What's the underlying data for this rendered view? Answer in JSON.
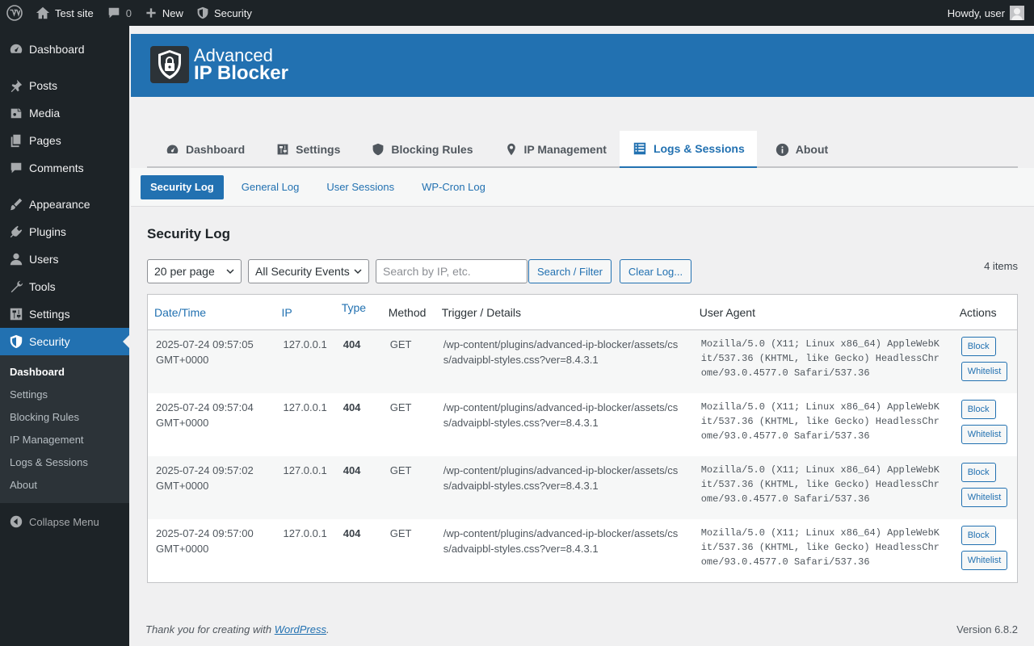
{
  "adminbar": {
    "site_name": "Test site",
    "comments_count": "0",
    "new_label": "New",
    "security_label": "Security",
    "greeting": "Howdy, user"
  },
  "sidebar": {
    "items": [
      {
        "label": "Dashboard",
        "icon": "dashboard-icon"
      },
      {
        "label": "Posts",
        "icon": "pin-icon"
      },
      {
        "label": "Media",
        "icon": "media-icon"
      },
      {
        "label": "Pages",
        "icon": "pages-icon"
      },
      {
        "label": "Comments",
        "icon": "comment-icon"
      },
      {
        "label": "Appearance",
        "icon": "brush-icon"
      },
      {
        "label": "Plugins",
        "icon": "plug-icon"
      },
      {
        "label": "Users",
        "icon": "user-icon"
      },
      {
        "label": "Tools",
        "icon": "wrench-icon"
      },
      {
        "label": "Settings",
        "icon": "settings-icon"
      },
      {
        "label": "Security",
        "icon": "shield-icon"
      }
    ],
    "submenu": [
      "Dashboard",
      "Settings",
      "Blocking Rules",
      "IP Management",
      "Logs & Sessions",
      "About"
    ],
    "collapse_label": "Collapse Menu"
  },
  "brand": {
    "line1": "Advanced",
    "line2": "IP Blocker"
  },
  "tabs": [
    "Dashboard",
    "Settings",
    "Blocking Rules",
    "IP Management",
    "Logs & Sessions",
    "About"
  ],
  "subtabs": [
    "Security Log",
    "General Log",
    "User Sessions",
    "WP-Cron Log"
  ],
  "page_title": "Security Log",
  "filters": {
    "per_page": "20 per page",
    "event_type": "All Security Events",
    "search_placeholder": "Search by IP, etc.",
    "search_button": "Search / Filter",
    "clear_button": "Clear Log..."
  },
  "items_count": "4 items",
  "table": {
    "headers": [
      "Date/Time",
      "IP",
      "Type",
      "Method",
      "Trigger / Details",
      "User Agent",
      "Actions"
    ],
    "rows": [
      {
        "date": "2025-07-24 09:57:05 GMT+0000",
        "ip": "127.0.0.1",
        "type": "404",
        "method": "GET",
        "trigger": "/wp-content/plugins/advanced-ip-blocker/assets/css/advaipbl-styles.css?ver=8.4.3.1",
        "ua": "Mozilla/5.0 (X11; Linux x86_64) AppleWebKit/537.36 (KHTML, like Gecko) HeadlessChrome/93.0.4577.0 Safari/537.36"
      },
      {
        "date": "2025-07-24 09:57:04 GMT+0000",
        "ip": "127.0.0.1",
        "type": "404",
        "method": "GET",
        "trigger": "/wp-content/plugins/advanced-ip-blocker/assets/css/advaipbl-styles.css?ver=8.4.3.1",
        "ua": "Mozilla/5.0 (X11; Linux x86_64) AppleWebKit/537.36 (KHTML, like Gecko) HeadlessChrome/93.0.4577.0 Safari/537.36"
      },
      {
        "date": "2025-07-24 09:57:02 GMT+0000",
        "ip": "127.0.0.1",
        "type": "404",
        "method": "GET",
        "trigger": "/wp-content/plugins/advanced-ip-blocker/assets/css/advaipbl-styles.css?ver=8.4.3.1",
        "ua": "Mozilla/5.0 (X11; Linux x86_64) AppleWebKit/537.36 (KHTML, like Gecko) HeadlessChrome/93.0.4577.0 Safari/537.36"
      },
      {
        "date": "2025-07-24 09:57:00 GMT+0000",
        "ip": "127.0.0.1",
        "type": "404",
        "method": "GET",
        "trigger": "/wp-content/plugins/advanced-ip-blocker/assets/css/advaipbl-styles.css?ver=8.4.3.1",
        "ua": "Mozilla/5.0 (X11; Linux x86_64) AppleWebKit/537.36 (KHTML, like Gecko) HeadlessChrome/93.0.4577.0 Safari/537.36"
      }
    ],
    "block_label": "Block",
    "whitelist_label": "Whitelist"
  },
  "footer": {
    "thanks_prefix": "Thank you for creating with ",
    "thanks_link": "WordPress",
    "thanks_suffix": ".",
    "version": "Version 6.8.2"
  },
  "colors": {
    "accent": "#2271b1",
    "admin_dark": "#1d2327"
  }
}
